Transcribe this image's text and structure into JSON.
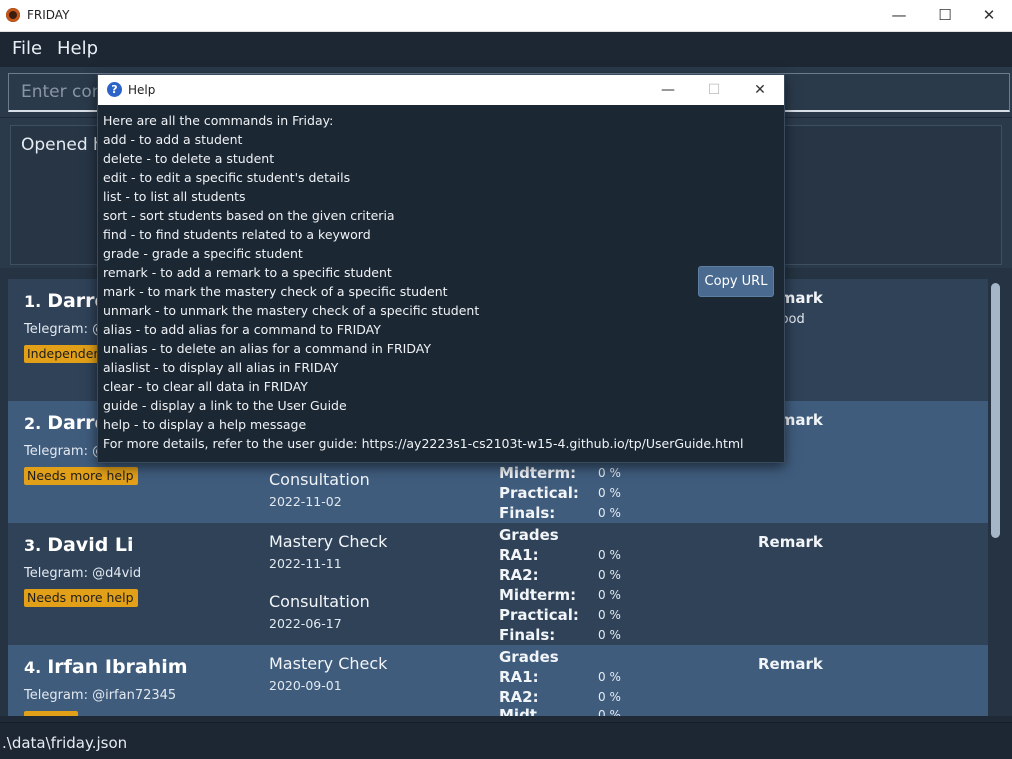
{
  "window": {
    "title": "FRIDAY",
    "minimize": "—",
    "maximize": "☐",
    "close": "✕"
  },
  "menu": {
    "file": "File",
    "help": "Help"
  },
  "command": {
    "placeholder": "Enter command here..."
  },
  "result": {
    "text": "Opened help window."
  },
  "students": [
    {
      "index": "1.",
      "name": "Darren",
      "telegram": "Telegram: @",
      "tag": "Independent",
      "remark_label": "Remark",
      "remark": "food"
    },
    {
      "index": "2.",
      "name": "Darre",
      "telegram": "Telegram: @",
      "tag": "Needs more help",
      "consultation_label": "Consultation",
      "consultation_date": "2022-11-02",
      "grades": [
        {
          "label": "Midterm:",
          "value": "0 %"
        },
        {
          "label": "Practical:",
          "value": "0 %"
        },
        {
          "label": "Finals:",
          "value": "0 %"
        }
      ],
      "remark_label": "Remark"
    },
    {
      "index": "3.",
      "name": "David Li",
      "telegram": "Telegram: @d4vid",
      "tag": "Needs more help",
      "mastery_label": "Mastery Check",
      "mastery_date": "2022-11-11",
      "consultation_label": "Consultation",
      "consultation_date": "2022-06-17",
      "grades_head": "Grades",
      "grades": [
        {
          "label": "RA1:",
          "value": "0 %"
        },
        {
          "label": "RA2:",
          "value": "0 %"
        },
        {
          "label": "Midterm:",
          "value": "0 %"
        },
        {
          "label": "Practical:",
          "value": "0 %"
        },
        {
          "label": "Finals:",
          "value": "0 %"
        }
      ],
      "remark_label": "Remark"
    },
    {
      "index": "4.",
      "name": "Irfan Ibrahim",
      "telegram": "Telegram: @irfan72345",
      "mastery_label": "Mastery Check",
      "mastery_date": "2020-09-01",
      "grades_head": "Grades",
      "grades": [
        {
          "label": "RA1:",
          "value": "0 %"
        },
        {
          "label": "RA2:",
          "value": "0 %"
        },
        {
          "label": "Midt",
          "value": "0 %"
        }
      ],
      "remark_label": "Remark"
    }
  ],
  "status": {
    "path": ".\\data\\friday.json"
  },
  "help": {
    "title": "Help",
    "lines": [
      "Here are all the commands in Friday:",
      "add - to add a student",
      "delete - to delete a student",
      "edit - to edit a specific student's details",
      "list - to list all students",
      "sort - sort students based on the given criteria",
      "find - to find students related to a keyword",
      "grade - grade a specific student",
      "remark - to add a remark to a specific student",
      "mark - to mark the mastery check of a specific student",
      "unmark - to unmark the mastery check of a specific student",
      "alias - to add alias for a command to FRIDAY",
      "unalias - to delete an alias for a command in FRIDAY",
      "aliaslist - to display all alias in FRIDAY",
      "clear - to clear all data in FRIDAY",
      "guide - display a link to the User Guide",
      "help - to display a help message",
      "For more details, refer to the user guide: https://ay2223s1-cs2103t-w15-4.github.io/tp/UserGuide.html"
    ],
    "copy_button": "Copy URL"
  }
}
